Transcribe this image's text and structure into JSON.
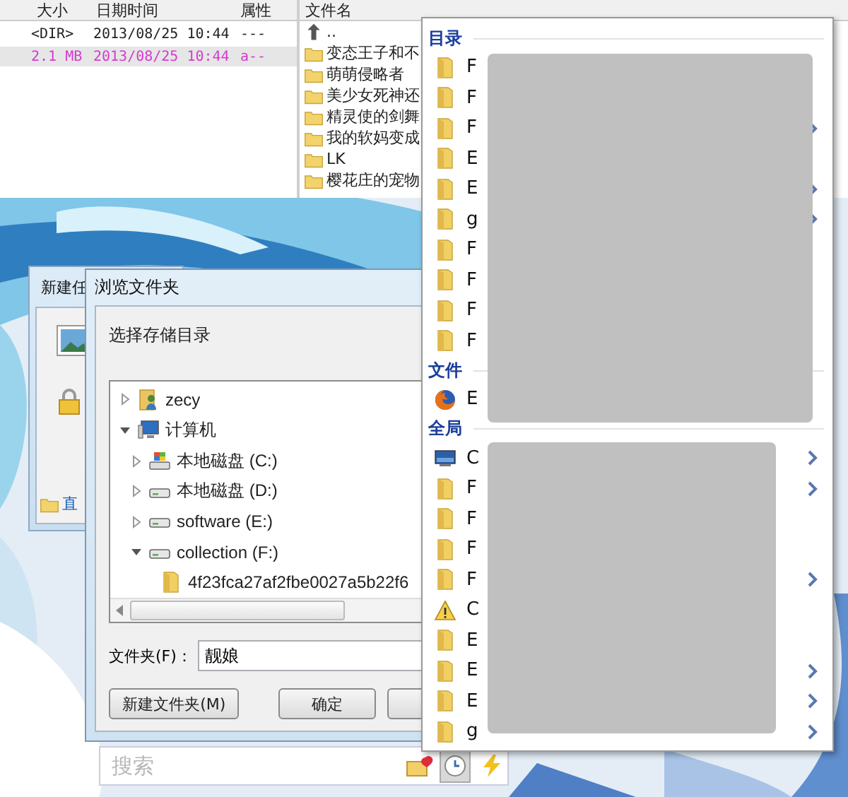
{
  "file_manager": {
    "left_columns": [
      "大小",
      "日期时间",
      "属性"
    ],
    "left_rows": [
      {
        "size": "<DIR>",
        "date": "2013/08/25 10:44",
        "attr": "---",
        "selected": false
      },
      {
        "size": "2.1 MB",
        "date": "2013/08/25 10:44",
        "attr": "a--",
        "selected": true
      }
    ],
    "right_column": "文件名",
    "right_rows": [
      {
        "kind": "up",
        "name": ".."
      },
      {
        "kind": "folder",
        "name": "变态王子和不"
      },
      {
        "kind": "folder",
        "name": "萌萌侵略者"
      },
      {
        "kind": "folder",
        "name": "美少女死神还"
      },
      {
        "kind": "folder",
        "name": "精灵使的剑舞"
      },
      {
        "kind": "folder",
        "name": "我的软妈变成"
      },
      {
        "kind": "folder",
        "name": "LK"
      },
      {
        "kind": "folder",
        "name": "樱花庄的宠物"
      }
    ]
  },
  "back_dialog": {
    "title": "新建任",
    "link": "直"
  },
  "browse_dialog": {
    "title": "浏览文件夹",
    "prompt": "选择存储目录",
    "tree": [
      {
        "label": "zecy",
        "kind": "user",
        "expanded": false
      },
      {
        "label": "计算机",
        "kind": "computer",
        "expanded": true,
        "children": [
          {
            "label": "本地磁盘 (C:)",
            "kind": "system-drive",
            "expanded": false
          },
          {
            "label": "本地磁盘 (D:)",
            "kind": "drive",
            "expanded": false
          },
          {
            "label": "software (E:)",
            "kind": "drive",
            "expanded": false
          },
          {
            "label": "collection (F:)",
            "kind": "drive",
            "expanded": true,
            "children": [
              {
                "label": "4f23fca27af2fbe0027a5b22f6",
                "kind": "folder"
              }
            ]
          }
        ]
      }
    ],
    "folder_label": "文件夹(F)：",
    "folder_value": "靓娘",
    "buttons": [
      "新建文件夹(M)",
      "确定"
    ]
  },
  "search": {
    "placeholder": "搜索"
  },
  "quick_menu": {
    "sections": [
      {
        "title": "目录",
        "items": [
          {
            "kind": "folder",
            "label": "F",
            "submenu": false
          },
          {
            "kind": "folder",
            "label": "F",
            "submenu": false
          },
          {
            "kind": "folder",
            "label": "F",
            "submenu": true
          },
          {
            "kind": "folder",
            "label": "E",
            "submenu": false
          },
          {
            "kind": "folder",
            "label": "E",
            "submenu": true
          },
          {
            "kind": "folder",
            "label": "g",
            "submenu": true
          },
          {
            "kind": "folder",
            "label": "F",
            "submenu": false
          },
          {
            "kind": "folder",
            "label": "F",
            "submenu": false
          },
          {
            "kind": "folder",
            "label": "F",
            "submenu": false
          },
          {
            "kind": "folder",
            "label": "F",
            "submenu": false
          }
        ]
      },
      {
        "title": "文件",
        "items": [
          {
            "kind": "browser",
            "label": "E",
            "submenu": false
          }
        ]
      },
      {
        "title": "全局",
        "items": [
          {
            "kind": "monitor",
            "label": "C",
            "submenu": true
          },
          {
            "kind": "folder",
            "label": "F",
            "submenu": true
          },
          {
            "kind": "folder",
            "label": "F",
            "submenu": false
          },
          {
            "kind": "folder",
            "label": "F",
            "submenu": false
          },
          {
            "kind": "folder",
            "label": "F",
            "submenu": true
          },
          {
            "kind": "warning",
            "label": "C",
            "submenu": false
          },
          {
            "kind": "folder",
            "label": "E",
            "submenu": false
          },
          {
            "kind": "folder",
            "label": "E",
            "submenu": true
          },
          {
            "kind": "folder",
            "label": "E",
            "submenu": true
          },
          {
            "kind": "folder",
            "label": "g",
            "submenu": true
          }
        ]
      }
    ]
  }
}
